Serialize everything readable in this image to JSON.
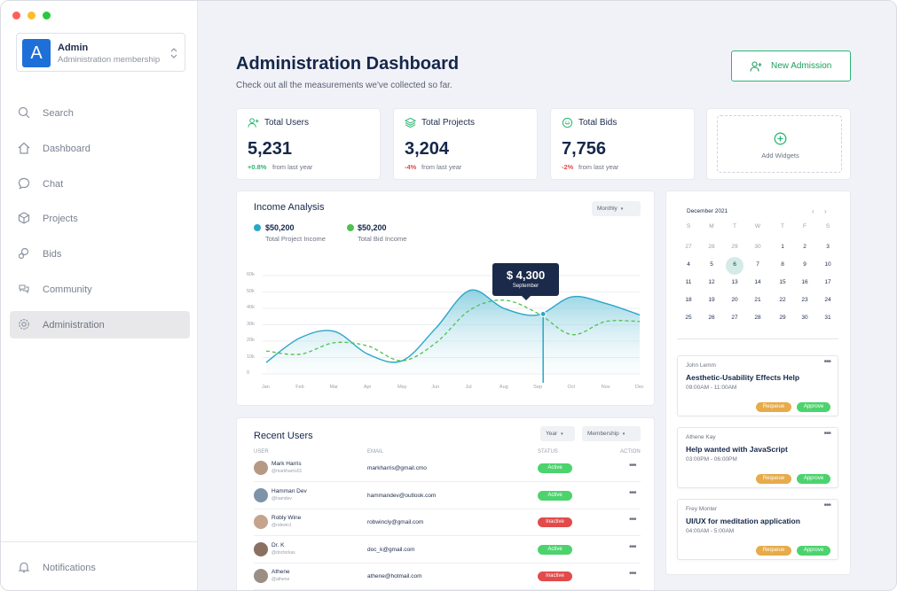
{
  "window_controls": {
    "colors": [
      "#ff5f57",
      "#febc2e",
      "#28c840"
    ]
  },
  "sidebar": {
    "account": {
      "initial": "A",
      "name": "Admin",
      "subtitle": "Administration membership"
    },
    "items": [
      {
        "label": "Search",
        "icon": "search-icon"
      },
      {
        "label": "Dashboard",
        "icon": "home-icon"
      },
      {
        "label": "Chat",
        "icon": "chat-icon"
      },
      {
        "label": "Projects",
        "icon": "box-icon"
      },
      {
        "label": "Bids",
        "icon": "bids-icon"
      },
      {
        "label": "Community",
        "icon": "community-icon"
      },
      {
        "label": "Administration",
        "icon": "gear-icon",
        "active": true
      }
    ],
    "footer": {
      "label": "Notifications",
      "icon": "bell-icon"
    }
  },
  "header": {
    "title": "Administration Dashboard",
    "subtitle": "Check out all the measurements we've collected so far.",
    "new_button": "New Admission"
  },
  "stats": [
    {
      "label": "Total Users",
      "value": "5,231",
      "change": "+0.8%",
      "note": "from last year",
      "trend": "up",
      "icon": "user-plus-icon"
    },
    {
      "label": "Total Projects",
      "value": "3,204",
      "change": "-4%",
      "note": "from last year",
      "trend": "down",
      "icon": "layers-icon"
    },
    {
      "label": "Total Bids",
      "value": "7,756",
      "change": "-2%",
      "note": "from last year",
      "trend": "down",
      "icon": "coin-icon"
    }
  ],
  "add_widget": {
    "label": "Add Widgets"
  },
  "income": {
    "title": "Income Analysis",
    "period": "Monthly",
    "legend": [
      {
        "value": "$50,200",
        "label": "Total Project Income",
        "color": "#2aa6c9"
      },
      {
        "value": "$50,200",
        "label": "Total Bid Income",
        "color": "#4cc24f"
      }
    ],
    "tooltip": {
      "value": "$ 4,300",
      "label": "September"
    }
  },
  "chart_data": {
    "type": "area",
    "categories": [
      "Jan",
      "Feb",
      "Mar",
      "Apr",
      "May",
      "Jun",
      "Jul",
      "Aug",
      "Sep",
      "Oct",
      "Nov",
      "Dec"
    ],
    "y_ticks": [
      "60k",
      "50k",
      "40k",
      "30k",
      "20k",
      "10k",
      "0"
    ],
    "ylim": [
      0,
      60
    ],
    "series": [
      {
        "values": [
          7,
          22,
          26,
          12,
          8,
          28,
          51,
          40,
          36,
          47,
          43,
          36
        ],
        "color": "#2aa6c9"
      },
      {
        "values": [
          14,
          12,
          19,
          17,
          8,
          19,
          39,
          45,
          37,
          24,
          32,
          32
        ],
        "color": "#4cc24f"
      }
    ],
    "highlight_index": 8
  },
  "recent_users": {
    "title": "Recent Users",
    "filters": [
      "Year",
      "Membership"
    ],
    "columns": [
      "USER",
      "EMAIL",
      "STATUS",
      "ACTION"
    ],
    "rows": [
      {
        "name": "Mark Harris",
        "handle": "@markharris01",
        "email": "markharris@gmail.cmo",
        "status": "Active"
      },
      {
        "name": "Hamman Dev",
        "handle": "@hamdev",
        "email": "hammandev@outlook.com",
        "status": "Active"
      },
      {
        "name": "Robly Wine",
        "handle": "@robwin1",
        "email": "robwincly@gmail.com",
        "status": "Inactive"
      },
      {
        "name": "Dr. K",
        "handle": "@doctorkas",
        "email": "doc_k@gmail.com",
        "status": "Active"
      },
      {
        "name": "Athene",
        "handle": "@athene",
        "email": "athene@hotmail.com",
        "status": "Inactive"
      }
    ],
    "status_colors": {
      "Active": "#4cd36d",
      "Inactive": "#e14b4b"
    }
  },
  "calendar": {
    "month": "December 2021",
    "weekdays": [
      "S",
      "M",
      "T",
      "W",
      "T",
      "F",
      "S"
    ],
    "weeks": [
      [
        "27",
        "28",
        "29",
        "30",
        "1",
        "2",
        "3"
      ],
      [
        "4",
        "5",
        "6",
        "7",
        "8",
        "9",
        "10"
      ],
      [
        "11",
        "12",
        "13",
        "14",
        "15",
        "16",
        "17"
      ],
      [
        "18",
        "19",
        "20",
        "21",
        "22",
        "23",
        "24"
      ],
      [
        "25",
        "26",
        "27",
        "28",
        "29",
        "30",
        "31"
      ]
    ],
    "selected": "6",
    "prev_icon": "chevron-left-icon",
    "next_icon": "chevron-right-icon"
  },
  "events": [
    {
      "author": "John Lemm",
      "title": "Aesthetic-Usability Effects Help",
      "time": "09:00AM - 11:00AM",
      "request": "Requeue",
      "approve": "Approve"
    },
    {
      "author": "Athene Kay",
      "title": "Help wanted with JavaScript",
      "time": "03:00PM - 06:00PM",
      "request": "Requeue",
      "approve": "Approve"
    },
    {
      "author": "Frey Monter",
      "title": "UI/UX for meditation application",
      "time": "04:00AM - 5:00AM",
      "request": "Requeue",
      "approve": "Approve"
    }
  ]
}
